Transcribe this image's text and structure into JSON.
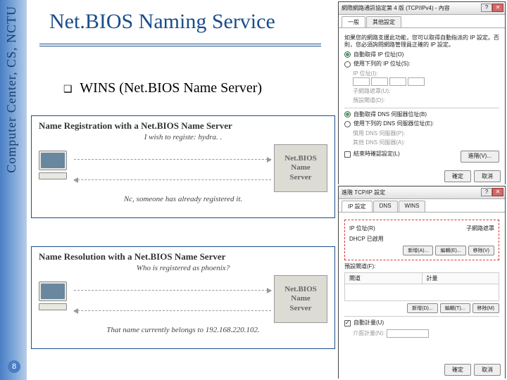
{
  "sidebar": {
    "text": "Computer Center, CS, NCTU"
  },
  "page_number": "8",
  "title": "Net.BIOS Naming Service",
  "bullet": {
    "symbol": "❑",
    "text": "WINS (Net.BIOS Name Server)"
  },
  "diagram1": {
    "title": "Name Registration with a Net.BIOS Name Server",
    "subtitle": "I wish to registe: hydra. .",
    "server_lines": [
      "Net.BIOS",
      "Name",
      "Server"
    ],
    "footer": "Nc, someone has already registered it."
  },
  "diagram2": {
    "title": "Name Resolution with a Net.BIOS Name Server",
    "subtitle": "Who is registered as phoenix?",
    "server_lines": [
      "Net.BIOS",
      "Name",
      "Server"
    ],
    "footer": "That name currently belongs to 192.168.220.102."
  },
  "dialog1": {
    "title_prefix": "網際網路通訊協定第 4 版 (TCP/IPv4) - 內容",
    "tabs": [
      "一般",
      "其他設定"
    ],
    "desc": "如果您的網路支援此功能，您可以取得自動指派的 IP 設定。否則，您必須詢問網路管理員正確的 IP 設定。",
    "radio_auto_ip": "自動取得 IP 位址(O)",
    "radio_manual_ip": "使用下列的 IP 位址(S):",
    "fields_ip": {
      "ip": "IP 位址(I):",
      "mask": "子網路遮罩(U):",
      "gateway": "預設閘道(D):"
    },
    "radio_auto_dns": "自動取得 DNS 伺服器位址(B)",
    "radio_manual_dns": "使用下列的 DNS 伺服器位址(E):",
    "fields_dns": {
      "pref": "慣用 DNS 伺服器(P):",
      "alt": "其他 DNS 伺服器(A):"
    },
    "checkbox_exit": "結束時確認設定(L)",
    "btn_advanced": "進階(V)...",
    "btn_ok": "確定",
    "btn_cancel": "取消"
  },
  "dialog2": {
    "title": "進階 TCP/IP 設定",
    "tabs": [
      "IP 設定",
      "DNS",
      "WINS"
    ],
    "sec_ip_label": "IP 位址(R)",
    "col1": "IP 位址",
    "col2": "子網路遮罩",
    "dhcp_note": "DHCP 已啟用",
    "btn_add": "新增(A)...",
    "btn_edit": "編輯(E)...",
    "btn_remove": "移除(V)",
    "sec_gw_label": "預設閘道(F):",
    "gw_col1": "閘道",
    "gw_col2": "計量",
    "btn_add2": "新增(D)...",
    "btn_edit2": "編輯(T)...",
    "btn_remove2": "移除(M)",
    "checkbox_auto_metric": "自動計量(U)",
    "metric_label": "介面計量(N):",
    "btn_ok": "確定",
    "btn_cancel": "取消"
  }
}
